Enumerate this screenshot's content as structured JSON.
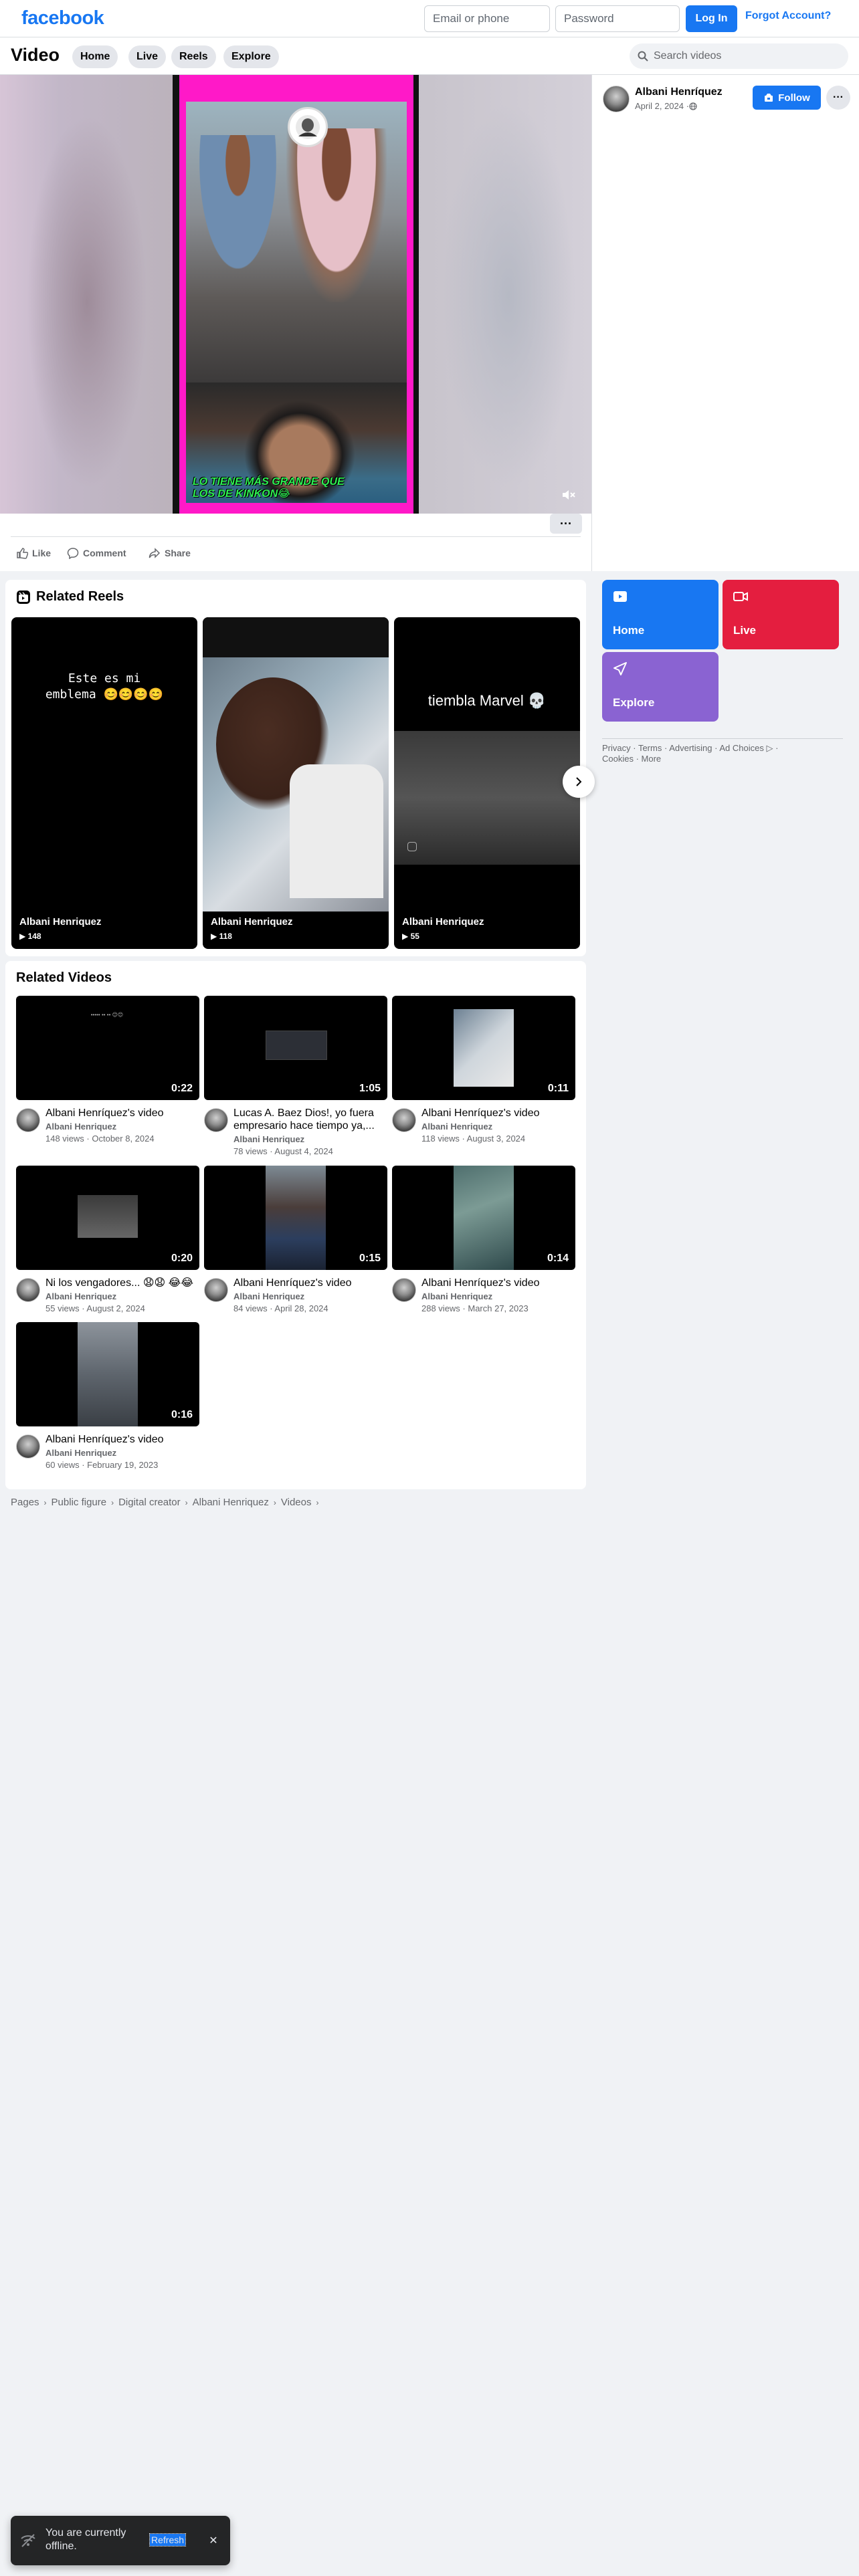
{
  "header": {
    "logo": "facebook",
    "email_placeholder": "Email or phone",
    "password_placeholder": "Password",
    "login_label": "Log In",
    "forgot_label": "Forgot Account?"
  },
  "subnav": {
    "title": "Video",
    "tabs": [
      "Home",
      "Live",
      "Reels",
      "Explore"
    ],
    "search_placeholder": "Search videos"
  },
  "player": {
    "caption": "LO TIENE MÁS GRANDE QUE LOS DE KINKON😂"
  },
  "actions": {
    "like": "Like",
    "comment": "Comment",
    "share": "Share",
    "more": "···"
  },
  "author_panel": {
    "name": "Albani Henríquez",
    "date": "April 2, 2024 · ",
    "follow_label": "Follow",
    "more": "···"
  },
  "related_reels": {
    "title": "Related Reels",
    "items": [
      {
        "text": "Este es mi emblema 😊😊😊😊",
        "name": "Albani Henriquez",
        "count": "▶ 148"
      },
      {
        "text": "",
        "name": "Albani Henriquez",
        "count": "▶ 118"
      },
      {
        "text": "tiembla Marvel 💀",
        "name": "Albani Henriquez",
        "count": "▶ 55"
      }
    ]
  },
  "nav_tiles": [
    {
      "label": "Home",
      "color": "#1877f2"
    },
    {
      "label": "Live",
      "color": "#e41e3f"
    },
    {
      "label": "Explore",
      "color": "#8a63d2"
    }
  ],
  "footer": {
    "links": [
      "Privacy",
      "Terms",
      "Advertising",
      "Ad Choices",
      "Cookies",
      "More"
    ]
  },
  "related_videos": {
    "title": "Related Videos",
    "items": [
      {
        "duration": "0:22",
        "title": "Albani Henríquez's video",
        "author": "Albani Henriquez",
        "stats": "148 views · October 8, 2024"
      },
      {
        "duration": "1:05",
        "title": "Lucas A. Baez Dios!, yo fuera empresario hace tiempo ya,...",
        "author": "Albani Henriquez",
        "stats": "78 views · August 4, 2024"
      },
      {
        "duration": "0:11",
        "title": "Albani Henríquez's video",
        "author": "Albani Henriquez",
        "stats": "118 views · August 3, 2024"
      },
      {
        "duration": "0:20",
        "title": "Ni los vengadores... 😧😧 😂😂",
        "author": "Albani Henriquez",
        "stats": "55 views · August 2, 2024"
      },
      {
        "duration": "0:15",
        "title": "Albani Henríquez's video",
        "author": "Albani Henriquez",
        "stats": "84 views · April 28, 2024"
      },
      {
        "duration": "0:14",
        "title": "Albani Henríquez's video",
        "author": "Albani Henriquez",
        "stats": "288 views · March 27, 2023"
      },
      {
        "duration": "0:16",
        "title": "Albani Henríquez's video",
        "author": "Albani Henriquez",
        "stats": "60 views · February 19, 2023"
      }
    ]
  },
  "breadcrumb": [
    "Pages",
    "Public figure",
    "Digital creator",
    "Albani Henriquez",
    "Videos"
  ],
  "toast": {
    "message": "You are currently offline.",
    "refresh": "Refresh"
  }
}
